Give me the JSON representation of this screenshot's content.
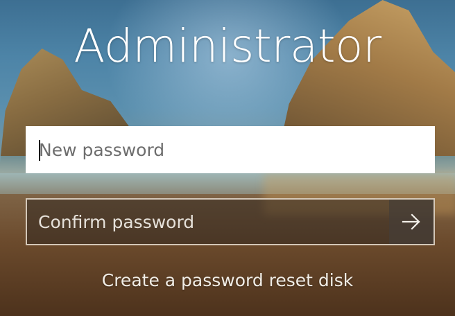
{
  "user": {
    "name": "Administrator"
  },
  "form": {
    "new_password": {
      "placeholder": "New password",
      "value": ""
    },
    "confirm_password": {
      "placeholder": "Confirm password",
      "value": ""
    },
    "submit_icon": "arrow-right-icon"
  },
  "links": {
    "reset_disk": "Create a password reset disk"
  },
  "colors": {
    "text": "#ffffff",
    "field_bg": "#ffffff",
    "confirm_bg": "rgba(50,40,32,0.55)"
  },
  "background": {
    "scene": "beach with rock formations"
  }
}
